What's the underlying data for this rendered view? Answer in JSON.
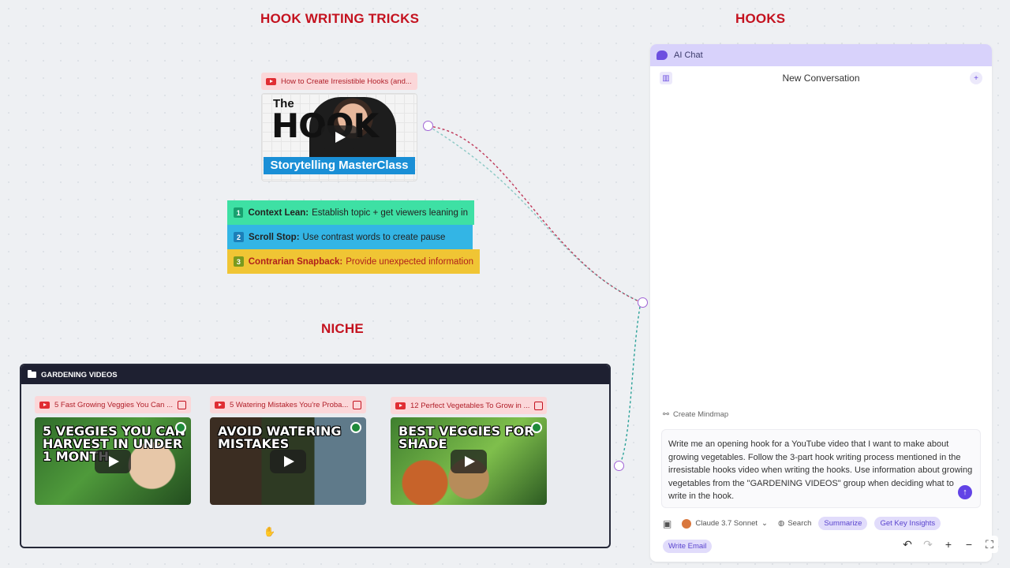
{
  "sections": {
    "hook_writing_tricks": "HOOK WRITING TRICKS",
    "hooks": "HOOKS",
    "niche": "NICHE"
  },
  "main_video": {
    "title": "How to Create Irresistible Hooks (and...",
    "thumb_line1": "The",
    "thumb_line2": "HOOK",
    "thumb_banner": "Storytelling MasterClass"
  },
  "steps": [
    {
      "num": "1",
      "title": "Context Lean:",
      "desc": "Establish topic + get viewers leaning in",
      "color": "#3ee0a4"
    },
    {
      "num": "2",
      "title": "Scroll Stop:",
      "desc": "Use contrast words to create pause",
      "color": "#33b5e5"
    },
    {
      "num": "3",
      "title": "Contrarian Snapback:",
      "desc": "Provide unexpected information",
      "color": "#f0c534"
    }
  ],
  "group": {
    "title": "GARDENING VIDEOS",
    "videos": [
      {
        "title": "5 Fast Growing Veggies You Can ...",
        "thumb_text": "5 VEGGIES YOU CAN HARVEST IN UNDER 1 MONTH"
      },
      {
        "title": "5 Watering Mistakes You're Proba...",
        "thumb_text": "AVOID WATERING MISTAKES"
      },
      {
        "title": "12 Perfect Vegetables To Grow in ...",
        "thumb_text": "BEST VEGGIES FOR SHADE"
      }
    ]
  },
  "chat": {
    "panel_label": "AI Chat",
    "conversation_title": "New Conversation",
    "create_mindmap": "Create Mindmap",
    "prompt_text": "Write me an opening hook for a YouTube video that I want to make about growing vegetables. Follow the 3-part hook writing process mentioned in the irresistable hooks video when writing the hooks. Use information about growing vegetables from the \"GARDENING VIDEOS\" group when deciding what to write in the hook.",
    "model": "Claude 3.7 Sonnet",
    "search": "Search",
    "chips": [
      "Summarize",
      "Get Key Insights",
      "Write Email"
    ]
  },
  "colors": {
    "section_title": "#c4121f",
    "chat_accent": "#6243e6",
    "connector_red": "#c0395a",
    "connector_teal": "#2aa198"
  }
}
